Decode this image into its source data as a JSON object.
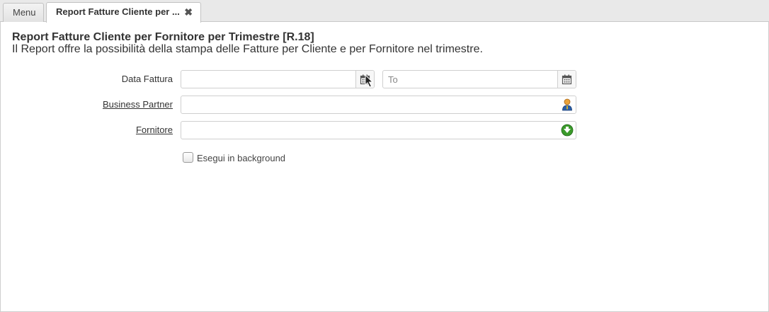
{
  "tabs": [
    {
      "label": "Menu"
    },
    {
      "label": "Report Fatture Cliente per ...",
      "close": "✖"
    }
  ],
  "header": {
    "title": "Report Fatture Cliente per Fornitore per Trimestre [R.18]",
    "description": "Il Report offre la possibilità della stampa delle Fatture per Cliente e per Fornitore nel trimestre."
  },
  "form": {
    "data_fattura": {
      "label": "Data Fattura",
      "value": "",
      "to_placeholder": "To"
    },
    "business_partner": {
      "label": "Business Partner",
      "value": ""
    },
    "fornitore": {
      "label": "Fornitore",
      "value": ""
    },
    "background": {
      "label": "Esegui in background",
      "checked": false
    }
  },
  "icons": {
    "date_from": "calendar-icon",
    "date_to": "calendar-icon",
    "bpartner": "business-partner-icon",
    "fornitore": "green-arrow-icon"
  }
}
